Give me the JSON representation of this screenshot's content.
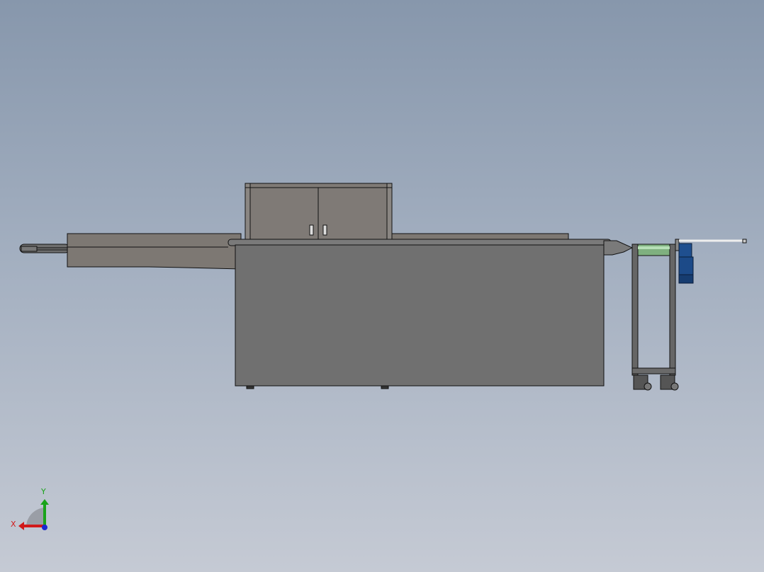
{
  "viewport": {
    "type": "cad-3d-view",
    "view": "front"
  },
  "triad": {
    "x_label": "X",
    "y_label": "Y",
    "x_color": "#d11a1a",
    "y_color": "#1aa31a",
    "z_color": "#1a2ad1"
  },
  "colors": {
    "body": "#707070",
    "cabinet": "#7f7a76",
    "conveyor": "#7d7873",
    "roller": "#7fb07f",
    "motor": "#1f4f8f"
  }
}
